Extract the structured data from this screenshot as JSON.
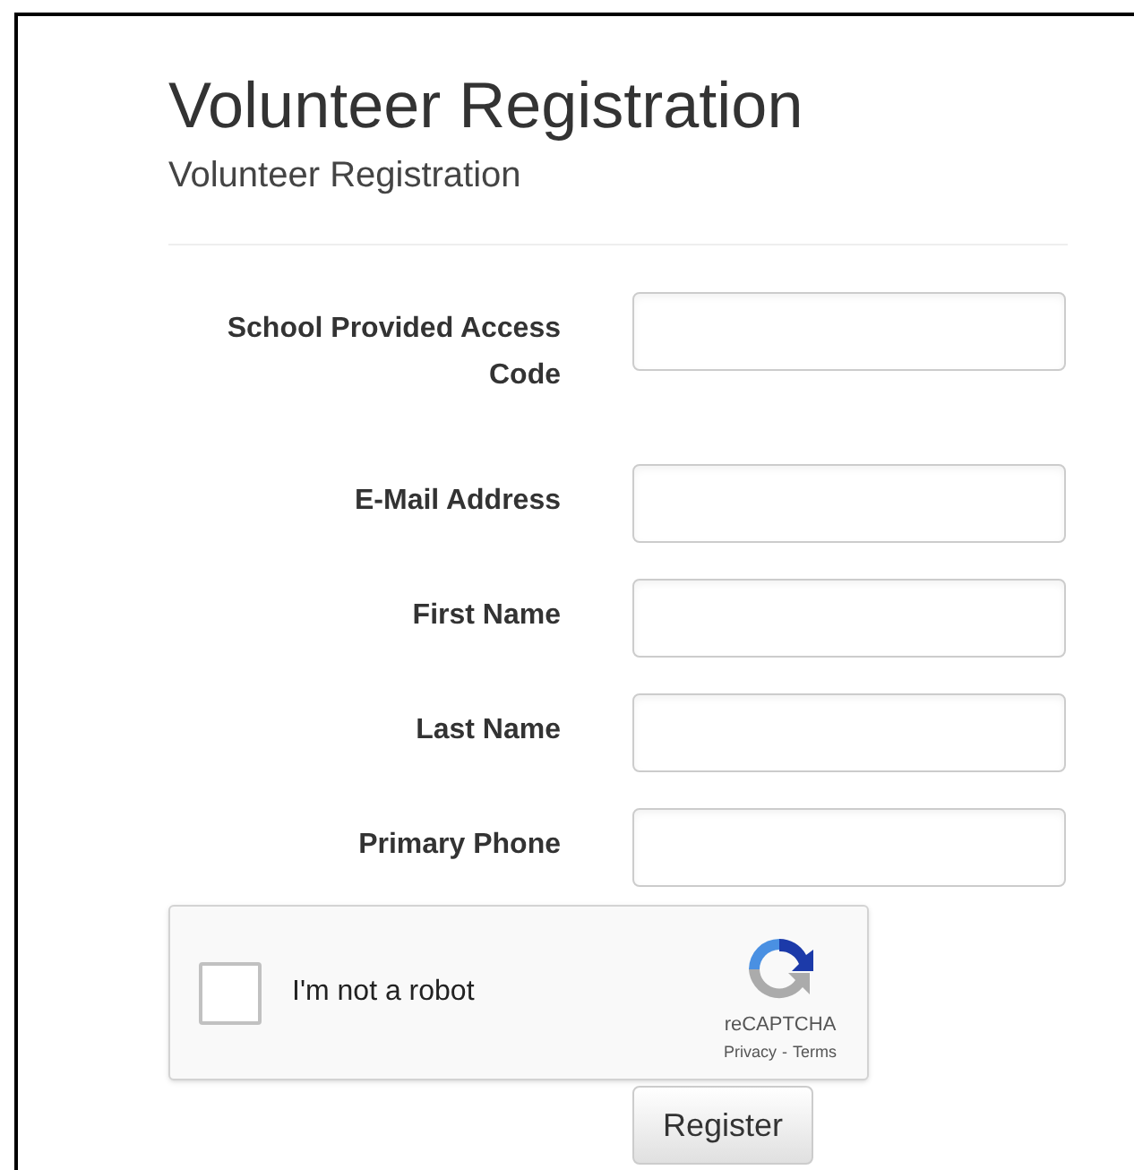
{
  "title": "Volunteer Registration",
  "subtitle": "Volunteer Registration",
  "fields": [
    {
      "label": "School Provided Access Code"
    },
    {
      "label": "E-Mail Address"
    },
    {
      "label": "First Name"
    },
    {
      "label": "Last Name"
    },
    {
      "label": "Primary Phone"
    }
  ],
  "captcha": {
    "label": "I'm not a robot",
    "checked": false,
    "brand": "reCAPTCHA",
    "links": [
      "Privacy",
      "Terms"
    ],
    "separator": "-"
  },
  "submit": "Register"
}
